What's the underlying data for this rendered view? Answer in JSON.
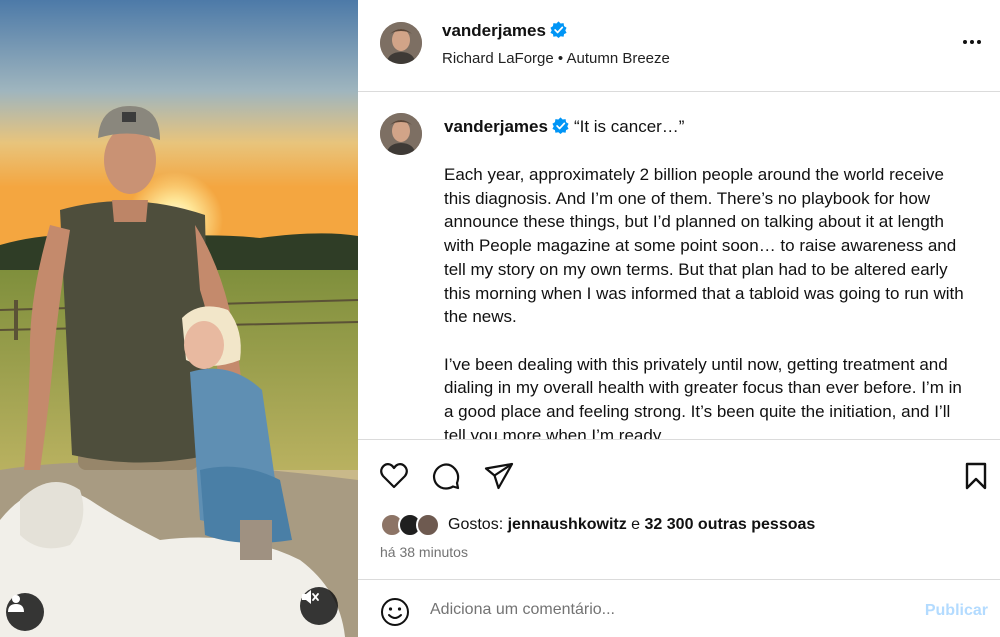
{
  "post": {
    "username": "vanderjames",
    "music": "Richard LaForge • Autumn Breeze",
    "caption_quote": "“It is cancer…”",
    "caption_paragraphs": [
      "Each year, approximately 2 billion people around the world receive this diagnosis. And I’m one of them. There’s no playbook for how announce these things, but I’d planned on talking about it at length with People magazine at some point soon… to raise awareness and tell my story on my own terms. But that plan had to be altered early this morning when I was informed that a tabloid was going to run with the news.",
      "I’ve been dealing with this privately until now, getting treatment and dialing in my overall health with greater focus than ever before. I’m in a good place and feeling strong. It’s been quite the initiation, and I’ll tell you more when I’m ready."
    ]
  },
  "likes": {
    "prefix": "Gostos:",
    "user": "jennaushkowitz",
    "connector": "e",
    "others": "32 300 outras pessoas"
  },
  "timestamp": "há 38 minutos",
  "comment": {
    "placeholder": "Adiciona um comentário...",
    "publish_label": "Publicar"
  },
  "icons": {
    "photo_user": "person-icon",
    "photo_mute": "speaker-muted-icon",
    "more": "more-horizontal-icon",
    "like": "heart-icon",
    "comment": "comment-bubble-icon",
    "share": "paper-plane-icon",
    "save": "bookmark-icon",
    "emoji": "smiley-icon",
    "verified": "verified-badge-icon"
  },
  "colors": {
    "verified": "#0095f6",
    "publish_disabled": "#b3dbff",
    "secondary_text": "#737373",
    "divider": "#dbdbdb"
  }
}
